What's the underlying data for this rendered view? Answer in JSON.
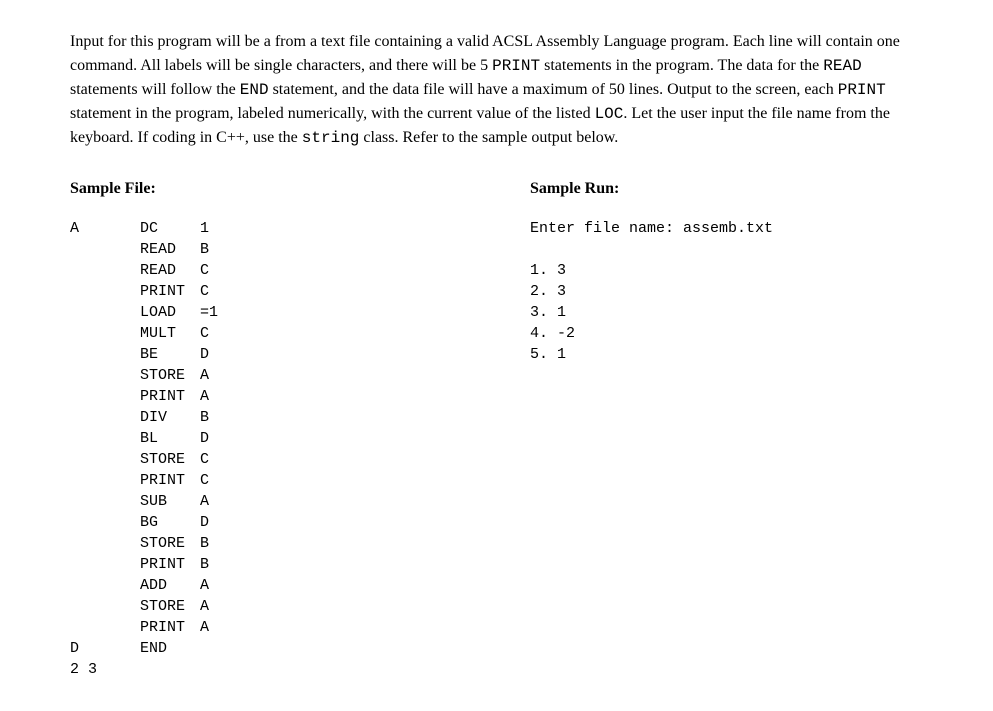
{
  "intro": {
    "p1": "Input for this program will be a from a text file containing a valid ACSL Assembly Language program. Each line will contain one command. All labels will be single characters, and there will be 5 ",
    "p1_mono1": "PRINT",
    "p2": " statements in the program. The data for the ",
    "p2_mono1": "READ",
    "p3": " statements will follow the ",
    "p3_mono1": "END",
    "p4": " statement, and the data file will have a maximum of 50 lines. Output to the screen, each ",
    "p4_mono1": "PRINT",
    "p5": " statement in the program, labeled numerically, with the current value of the listed ",
    "p5_mono1": "LOC",
    "p6": ". Let the user input the file name from the keyboard. If coding in C++, use the ",
    "p6_mono1": "string",
    "p7": " class. Refer to the sample output below."
  },
  "sampleFileTitle": "Sample File:",
  "sampleRunTitle": "Sample Run:",
  "sampleFile": {
    "lines": [
      {
        "label": "A",
        "op": "DC",
        "arg": "1"
      },
      {
        "label": "",
        "op": "READ",
        "arg": "B"
      },
      {
        "label": "",
        "op": "READ",
        "arg": "C"
      },
      {
        "label": "",
        "op": "PRINT",
        "arg": "C"
      },
      {
        "label": "",
        "op": "LOAD",
        "arg": "=1"
      },
      {
        "label": "",
        "op": "MULT",
        "arg": "C"
      },
      {
        "label": "",
        "op": "BE",
        "arg": "D"
      },
      {
        "label": "",
        "op": "STORE",
        "arg": "A"
      },
      {
        "label": "",
        "op": "PRINT",
        "arg": "A"
      },
      {
        "label": "",
        "op": "DIV",
        "arg": "B"
      },
      {
        "label": "",
        "op": "BL",
        "arg": "D"
      },
      {
        "label": "",
        "op": "STORE",
        "arg": "C"
      },
      {
        "label": "",
        "op": "PRINT",
        "arg": "C"
      },
      {
        "label": "",
        "op": "SUB",
        "arg": "A"
      },
      {
        "label": "",
        "op": "BG",
        "arg": "D"
      },
      {
        "label": "",
        "op": "STORE",
        "arg": "B"
      },
      {
        "label": "",
        "op": "PRINT",
        "arg": "B"
      },
      {
        "label": "",
        "op": "ADD",
        "arg": "A"
      },
      {
        "label": "",
        "op": "STORE",
        "arg": "A"
      },
      {
        "label": "",
        "op": "PRINT",
        "arg": "A"
      },
      {
        "label": "D",
        "op": "END",
        "arg": ""
      }
    ],
    "trailer": "2 3"
  },
  "sampleRun": {
    "prompt": "Enter file name: assemb.txt",
    "outputs": [
      "1. 3",
      "2. 3",
      "3. 1",
      "4. -2",
      "5. 1"
    ]
  }
}
